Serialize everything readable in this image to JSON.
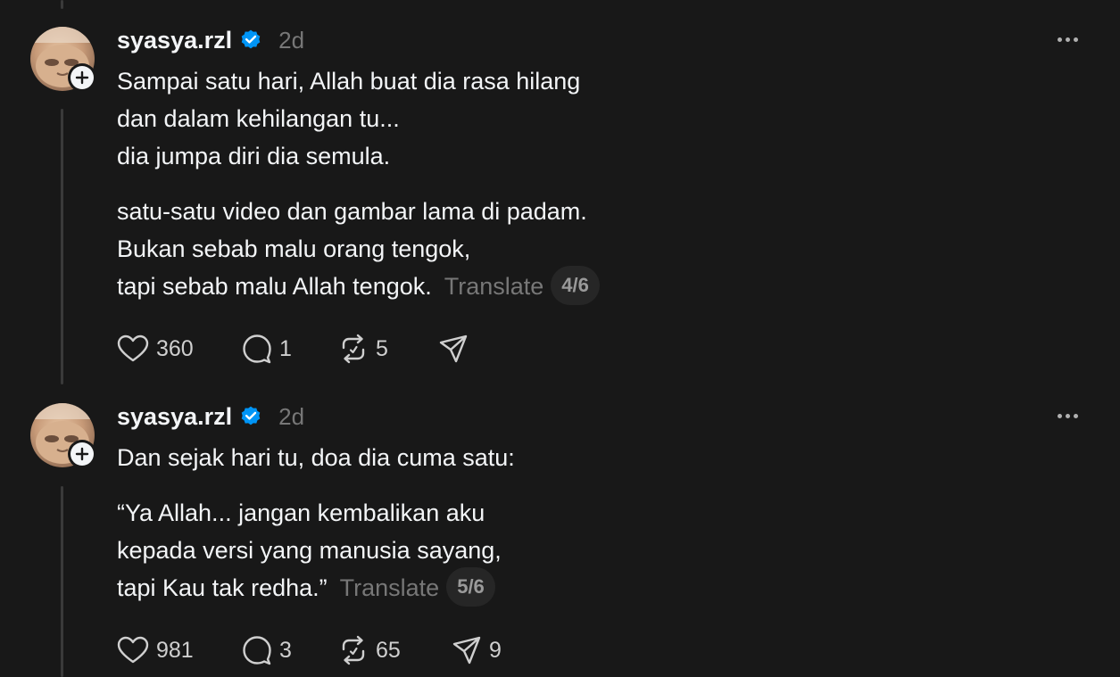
{
  "posts": [
    {
      "username": "syasya.rzl",
      "timestamp": "2d",
      "paragraphs": [
        [
          "Sampai satu hari, Allah buat dia rasa hilang",
          "dan dalam kehilangan tu...",
          "dia jumpa diri dia semula."
        ],
        [
          "satu-satu video dan gambar lama di padam.",
          "Bukan sebab malu orang tengok,",
          "tapi sebab malu Allah tengok."
        ]
      ],
      "translate_label": "Translate",
      "page_indicator": "4/6",
      "likes": "360",
      "replies": "1",
      "reposts": "5",
      "shares": ""
    },
    {
      "username": "syasya.rzl",
      "timestamp": "2d",
      "paragraphs": [
        [
          "Dan sejak hari tu, doa dia cuma satu:"
        ],
        [
          "“Ya Allah... jangan kembalikan aku",
          "kepada versi yang manusia sayang,",
          "tapi Kau tak redha.”"
        ]
      ],
      "translate_label": "Translate",
      "page_indicator": "5/6",
      "likes": "981",
      "replies": "3",
      "reposts": "65",
      "shares": "9"
    }
  ],
  "colors": {
    "background": "#181818",
    "text": "#f3f5f7",
    "muted": "#777777",
    "verified": "#0095f6",
    "thread_line": "#3a3a3a"
  },
  "icons": [
    "follow-plus-icon",
    "verified-badge-icon",
    "more-options-icon",
    "heart-icon",
    "comment-icon",
    "repost-icon",
    "share-icon"
  ]
}
